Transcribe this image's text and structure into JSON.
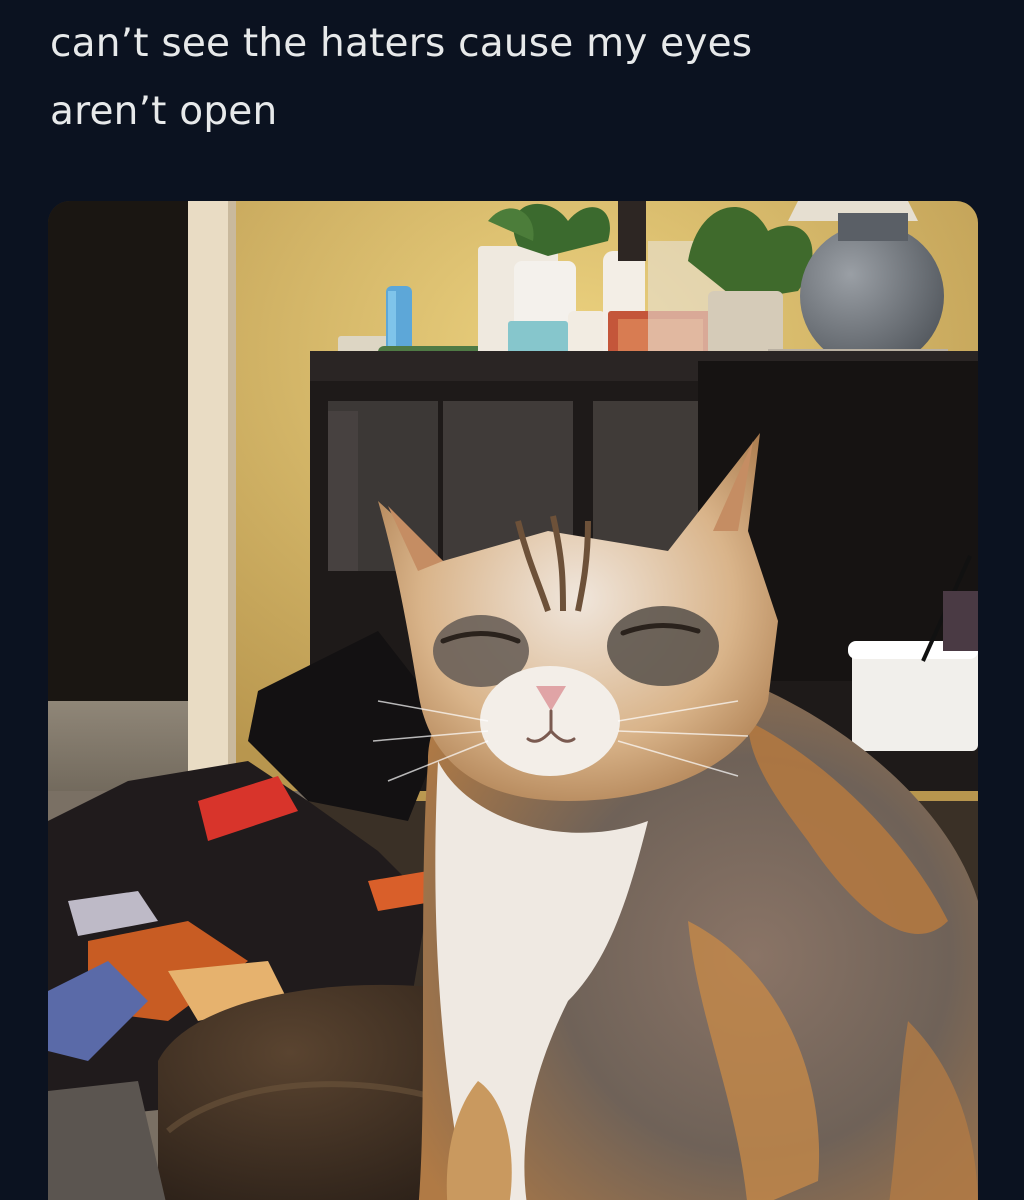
{
  "tweet": {
    "line1": "can’t see the haters cause my eyes",
    "line2": "aren’t open"
  },
  "media": {
    "alt": "photo of a calico cat with eyes closed sitting in a bedroom",
    "colors": {
      "background": "#0b1220",
      "text": "#e7e9ea",
      "wall": "#d9b86a",
      "dresser": "#1f1b1a",
      "cat_orange": "#c98a4c",
      "cat_white": "#eee8e0",
      "cat_gray": "#6b625a"
    }
  }
}
